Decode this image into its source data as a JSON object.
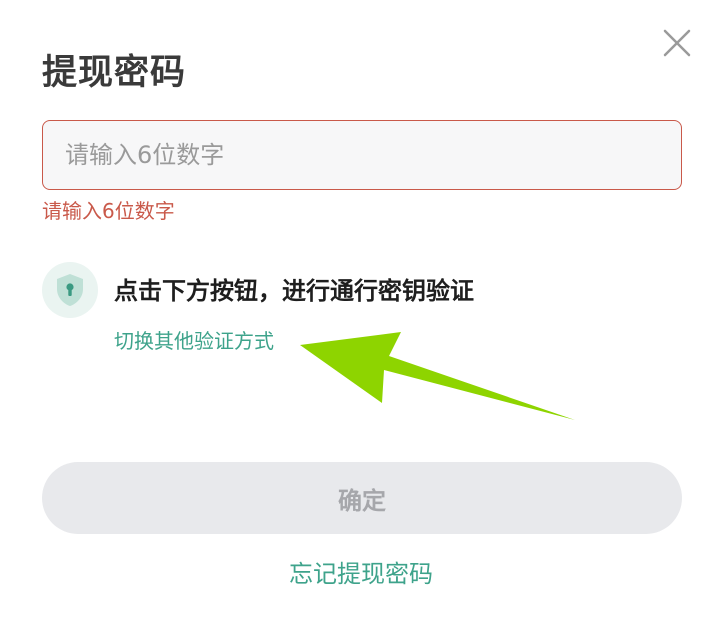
{
  "dialog": {
    "title": "提现密码",
    "password_input": {
      "value": "",
      "placeholder": "请输入6位数字"
    },
    "error_message": "请输入6位数字",
    "passkey": {
      "icon": "shield-lock-icon",
      "text": "点击下方按钮，进行通行密钥验证",
      "switch_link": "切换其他验证方式"
    },
    "confirm_label": "确定",
    "forgot_link": "忘记提现密码",
    "colors": {
      "error": "#c9594a",
      "accent": "#3ea38b",
      "button_bg": "#e8e9ec",
      "button_text": "#a6a7ab",
      "annotation_arrow": "#8ed400"
    },
    "close_icon": "close-icon"
  }
}
